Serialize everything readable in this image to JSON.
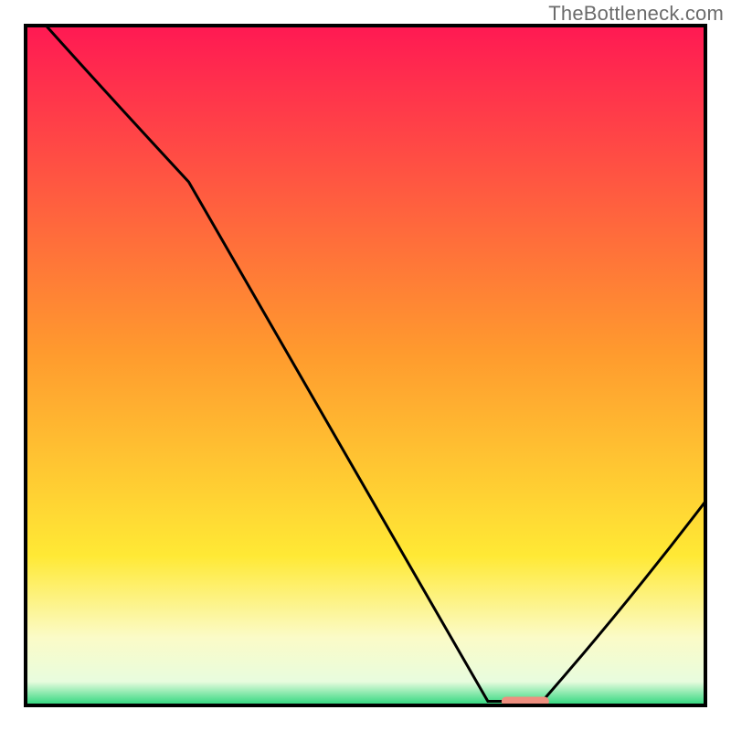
{
  "watermark": "TheBottleneck.com",
  "chart_data": {
    "type": "line",
    "title": "",
    "xlabel": "",
    "ylabel": "",
    "xlim": [
      0,
      100
    ],
    "ylim": [
      0,
      100
    ],
    "x": [
      3,
      24,
      68,
      72,
      76,
      100
    ],
    "values": [
      100,
      77,
      0.6,
      0.6,
      0.6,
      30
    ],
    "valley_marker": {
      "x_range": [
        70,
        77
      ],
      "y": 0.6,
      "color": "#ee8f7f"
    },
    "gradient_stops": [
      {
        "offset": 0.0,
        "color": "#ff1953"
      },
      {
        "offset": 0.48,
        "color": "#ff9a2e"
      },
      {
        "offset": 0.78,
        "color": "#ffe935"
      },
      {
        "offset": 0.9,
        "color": "#fbfbc7"
      },
      {
        "offset": 0.965,
        "color": "#e8fcde"
      },
      {
        "offset": 0.985,
        "color": "#7ae6a5"
      },
      {
        "offset": 1.0,
        "color": "#2bd67b"
      }
    ],
    "frame_color": "#000000",
    "curve_color": "#000000"
  }
}
